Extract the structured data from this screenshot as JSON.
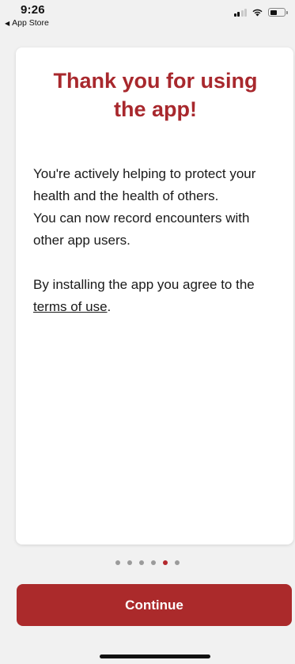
{
  "status_bar": {
    "time": "9:26",
    "back_app_label": "App Store",
    "back_icon": "back-triangle-icon",
    "icons": [
      "signal-icon",
      "wifi-icon",
      "battery-icon"
    ]
  },
  "card": {
    "title": "Thank you for using the app!",
    "paragraph1_line1": "You're actively helping to protect your health and the health of others.",
    "paragraph1_line2": "You can now record encounters with other app users.",
    "paragraph2_prefix": "By installing the app you agree to the ",
    "terms_link": "terms of use",
    "paragraph2_suffix": "."
  },
  "pager": {
    "total": 6,
    "active_index": 4
  },
  "continue_label": "Continue",
  "colors": {
    "accent": "#ab2a2b",
    "background": "#f1f1f1",
    "card": "#ffffff"
  }
}
